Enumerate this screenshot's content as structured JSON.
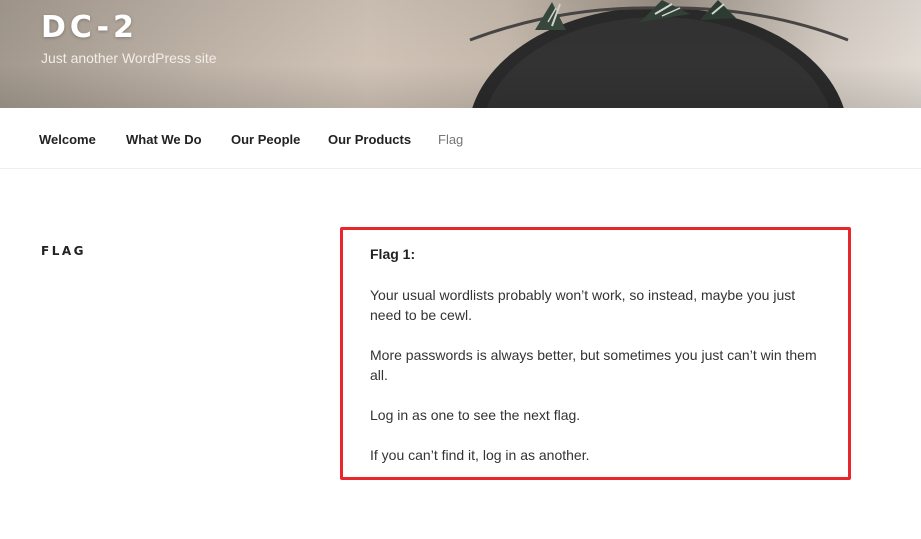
{
  "site": {
    "title": "DC-2",
    "description": "Just another WordPress site"
  },
  "nav": {
    "items": [
      {
        "label": "Welcome",
        "current": false
      },
      {
        "label": "What We Do",
        "current": false
      },
      {
        "label": "Our People",
        "current": false
      },
      {
        "label": "Our Products",
        "current": false
      },
      {
        "label": "Flag",
        "current": true
      }
    ]
  },
  "page": {
    "title": "FLAG",
    "content": {
      "heading": "Flag 1:",
      "paragraphs": [
        "Your usual wordlists probably won’t work, so instead, maybe you just need to be cewl.",
        "More passwords is always better, but sometimes you just can’t win them all.",
        "Log in as one to see the next flag.",
        "If you can’t find it, log in as another."
      ]
    }
  },
  "colors": {
    "highlight_border": "#e8262b",
    "nav_current": "#767676",
    "header_text": "#ffffff"
  }
}
